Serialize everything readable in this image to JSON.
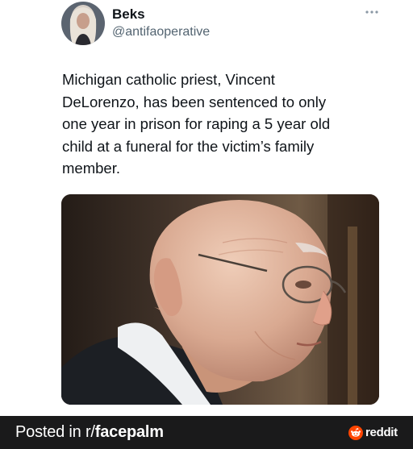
{
  "author": {
    "name": "Beks",
    "handle": "@antifaoperative",
    "avatar_icon": "profile-avatar"
  },
  "post": {
    "text_lines": [
      "Michigan catholic priest, Vincent",
      "DeLorenzo, has been sentenced to only",
      "one year in prison for raping a 5 year old",
      "child at a funeral for the victim’s family",
      "member."
    ],
    "more_icon": "more-options-icon",
    "media_icon": "photo-elderly-man"
  },
  "footer": {
    "posted_prefix": "Posted in r/",
    "subreddit": "facepalm",
    "brand": "reddit",
    "brand_icon": "reddit-logo-icon",
    "brand_color": "#ff4500",
    "bar_color": "#1a1a1b"
  }
}
